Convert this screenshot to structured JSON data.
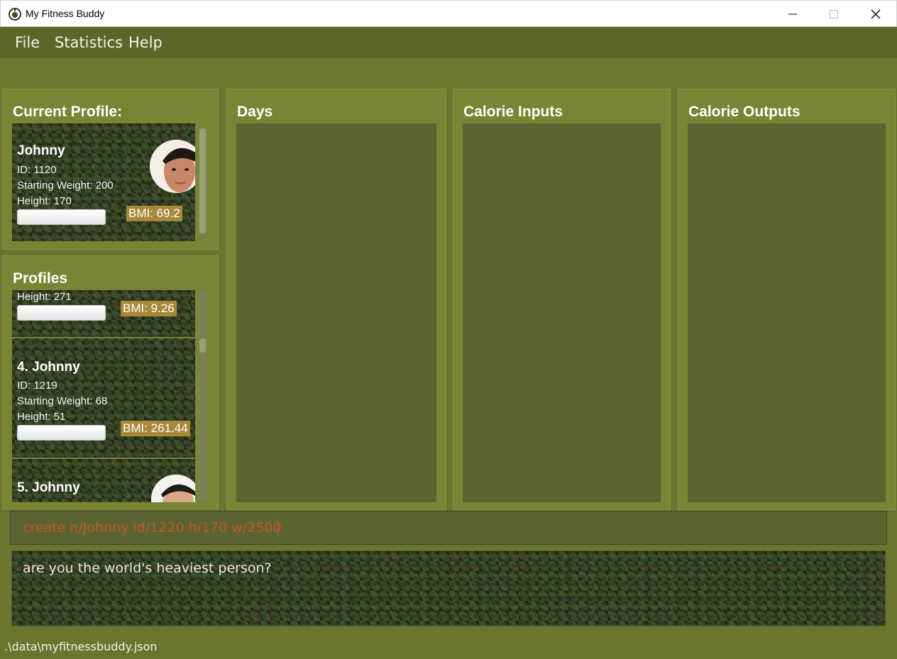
{
  "window": {
    "title": "My Fitness Buddy"
  },
  "menu": {
    "items": [
      "File",
      "Statistics",
      "Help"
    ]
  },
  "current_profile": {
    "title": "Current Profile:",
    "name": "Johnny",
    "id": "ID: 1120",
    "weight": "Starting Weight: 200",
    "height": "Height: 170",
    "bmi": "BMI: 69.2"
  },
  "profiles": {
    "title": "Profiles",
    "items": [
      {
        "height": "Height: 271",
        "bmi": "BMI: 9.26"
      },
      {
        "name": "4.  Johnny",
        "id": "ID: 1219",
        "weight": "Starting Weight: 68",
        "height": "Height: 51",
        "bmi": "BMI: 261.44"
      },
      {
        "name": "5.  Johnny"
      }
    ]
  },
  "panels": {
    "days": "Days",
    "calorie_inputs": "Calorie Inputs",
    "calorie_outputs": "Calorie Outputs"
  },
  "command": {
    "value": "create n/Johnny id/1220 h/170 w/2500"
  },
  "result": {
    "text": "are you the world's heaviest person?"
  },
  "status": {
    "path": ".\\data\\myfitnessbuddy.json"
  },
  "colors": {
    "accent_bg": "#798534",
    "dark_bg": "#5b6330",
    "bmi_badge": "#a8893a",
    "command_text": "#c1562a"
  }
}
